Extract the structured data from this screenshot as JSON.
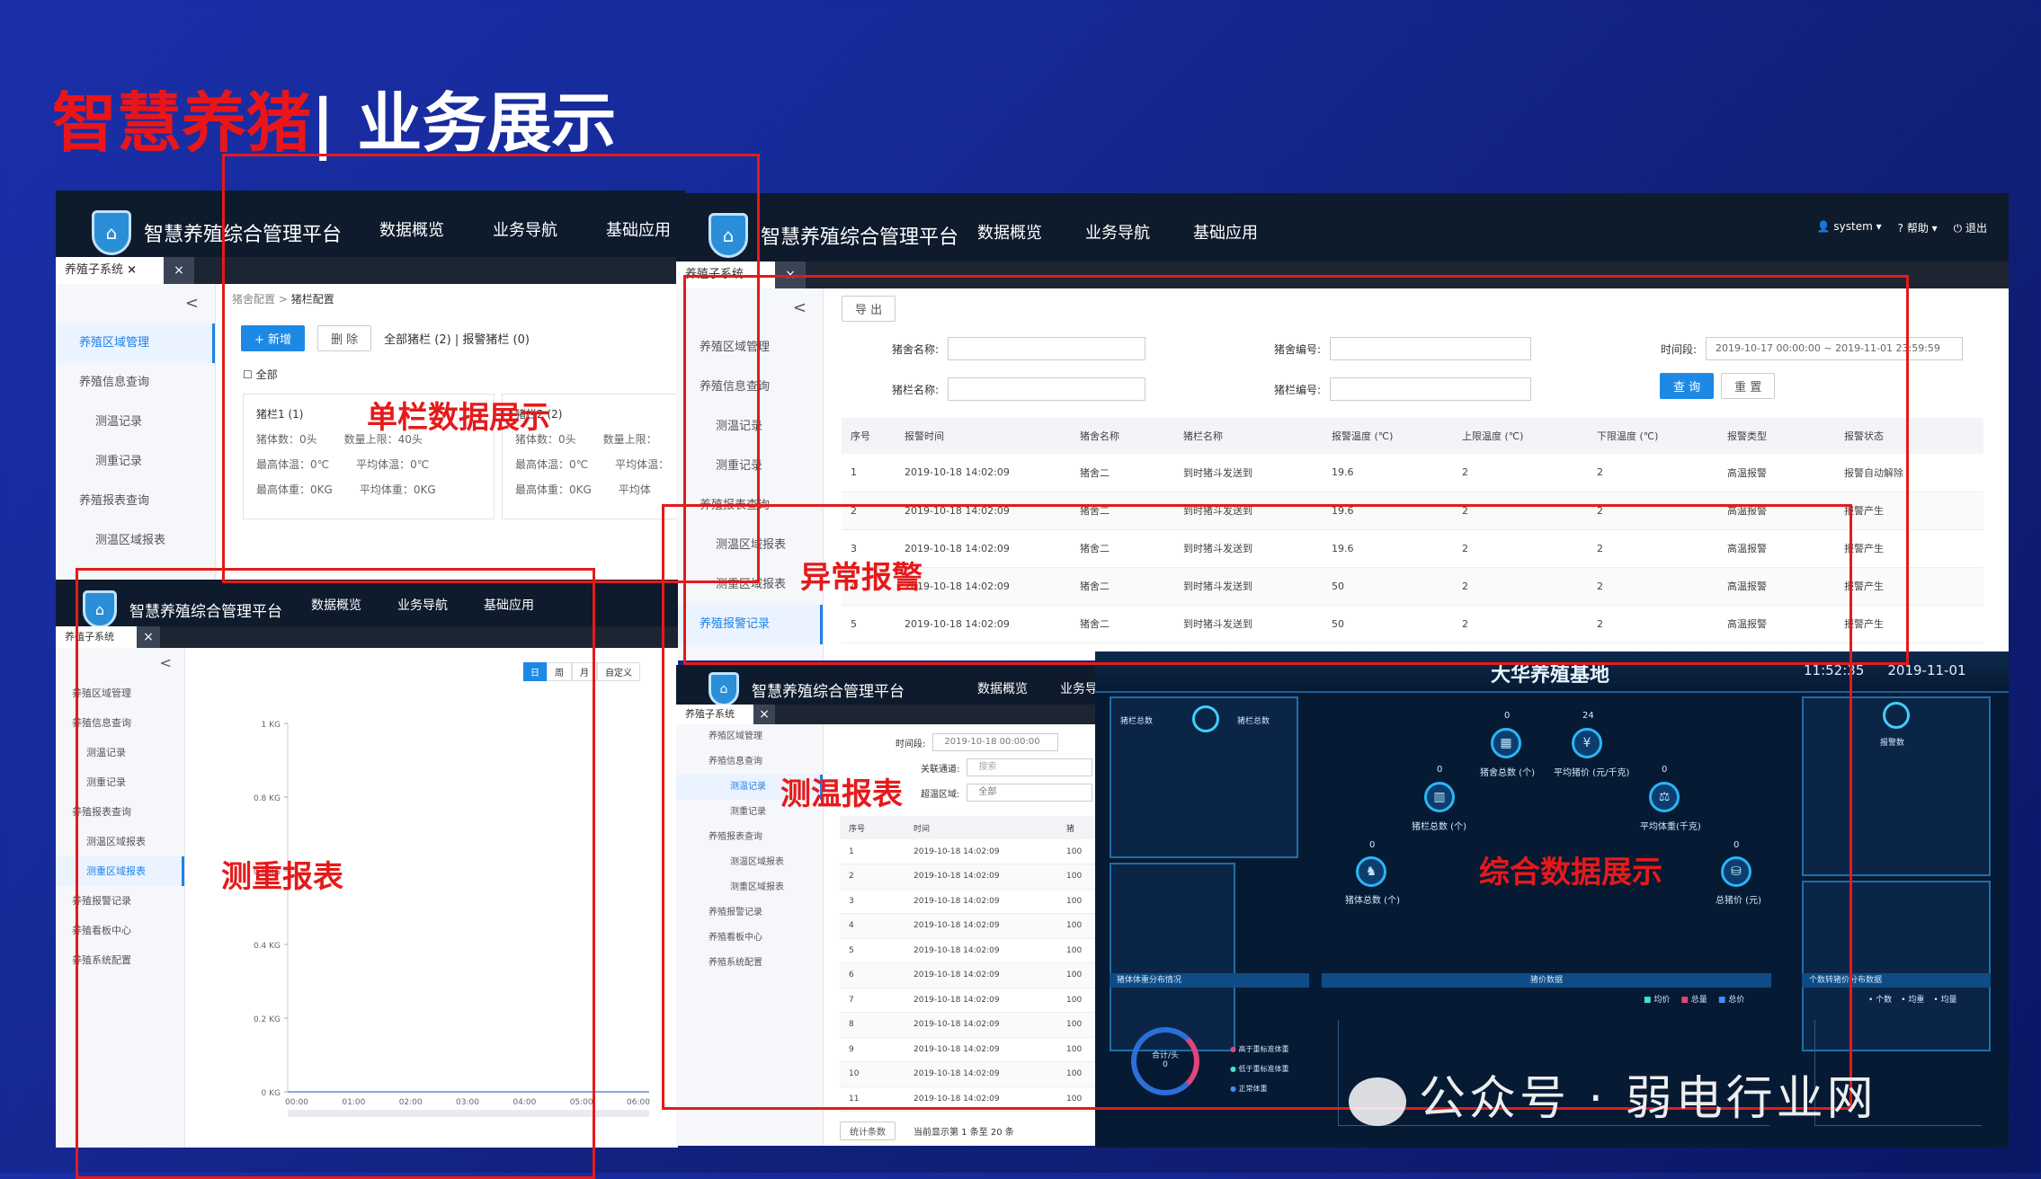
{
  "slide": {
    "title_red": "智慧养猪",
    "title_white": "| 业务展示"
  },
  "app": {
    "name": "智慧养殖综合管理平台",
    "nav": [
      "数据概览",
      "业务导航",
      "基础应用"
    ],
    "tab": "养殖子系统",
    "tab_close": "×",
    "user": "system",
    "help": "帮助",
    "logout": "退出"
  },
  "sidebar": {
    "collapse": "<",
    "items": [
      "养殖区域管理",
      "养殖信息查询",
      "测温记录",
      "测重记录",
      "养殖报表查询",
      "测温区域报表",
      "测重区域报表",
      "养殖报警记录",
      "养殖看板中心",
      "养殖系统配置"
    ]
  },
  "screen1": {
    "breadcrumb_root": "猪舍配置",
    "breadcrumb_sep": ">",
    "breadcrumb_current": "猪栏配置",
    "add": "+ 新增",
    "delete": "删 除",
    "stats": "全部猪栏 (2) | 报警猪栏 (0)",
    "select_all": "全部",
    "pens": [
      {
        "name": "猪栏1 (1)",
        "count": "猪体数：0头",
        "max": "数量上限：40头",
        "maxtemp": "最高体温：0℃",
        "avgtemp": "平均体温：0℃",
        "maxweight": "最高体重：0KG",
        "avgweight": "平均体重：0KG"
      },
      {
        "name": "猪栏2 (2)",
        "count": "猪体数：0头",
        "max": "数量上限：",
        "maxtemp": "最高体温：0℃",
        "avgtemp": "平均体温：",
        "maxweight": "最高体重：0KG",
        "avgweight": "平均体"
      }
    ],
    "label": "单栏数据展示"
  },
  "screen2": {
    "export": "导 出",
    "f_house_name": "猪舍名称:",
    "f_house_no": "猪舍编号:",
    "f_pen_name": "猪栏名称:",
    "f_pen_no": "猪栏编号:",
    "f_time": "时间段:",
    "time_value": "2019-10-17 00:00:00  ~  2019-11-01 23:59:59",
    "search": "查 询",
    "reset": "重 置",
    "headers": [
      "序号",
      "报警时间",
      "猪舍名称",
      "猪栏名称",
      "报警温度 (℃)",
      "上限温度 (℃)",
      "下限温度 (℃)",
      "报警类型",
      "报警状态"
    ],
    "rows": [
      [
        "1",
        "2019-10-18 14:02:09",
        "猪舍二",
        "到时猪斗发送到",
        "19.6",
        "2",
        "2",
        "高温报警",
        "报警自动解除"
      ],
      [
        "2",
        "2019-10-18 14:02:09",
        "猪舍二",
        "到时猪斗发送到",
        "19.6",
        "2",
        "2",
        "高温报警",
        "报警产生"
      ],
      [
        "3",
        "2019-10-18 14:02:09",
        "猪舍二",
        "到时猪斗发送到",
        "19.6",
        "2",
        "2",
        "高温报警",
        "报警产生"
      ],
      [
        "4",
        "2019-10-18 14:02:09",
        "猪舍二",
        "到时猪斗发送到",
        "50",
        "2",
        "2",
        "高温报警",
        "报警产生"
      ],
      [
        "5",
        "2019-10-18 14:02:09",
        "猪舍二",
        "到时猪斗发送到",
        "50",
        "2",
        "2",
        "高温报警",
        "报警产生"
      ]
    ],
    "label": "异常报警"
  },
  "screen3": {
    "toggles": [
      "日",
      "周",
      "月",
      "自定义"
    ],
    "yticks": [
      "1 KG",
      "0.8 KG",
      "0.6 KG",
      "0.4 KG",
      "0.2 KG",
      "0 KG"
    ],
    "xticks": [
      "00:00",
      "01:00",
      "02:00",
      "03:00",
      "04:00",
      "05:00",
      "06:00"
    ],
    "label": "测重报表"
  },
  "screen4": {
    "time_label": "时间段:",
    "time_value": "2019-10-18 00:00:00",
    "channel_label": "关联通道:",
    "channel_ph": "搜索",
    "area_label": "超温区域:",
    "area_value": "全部",
    "headers": [
      "序号",
      "时间",
      "猪"
    ],
    "rows": [
      [
        "1",
        "2019-10-18 14:02:09",
        "100"
      ],
      [
        "2",
        "2019-10-18 14:02:09",
        "100"
      ],
      [
        "3",
        "2019-10-18 14:02:09",
        "100"
      ],
      [
        "4",
        "2019-10-18 14:02:09",
        "100"
      ],
      [
        "5",
        "2019-10-18 14:02:09",
        "100"
      ],
      [
        "6",
        "2019-10-18 14:02:09",
        "100"
      ],
      [
        "7",
        "2019-10-18 14:02:09",
        "100"
      ],
      [
        "8",
        "2019-10-18 14:02:09",
        "100"
      ],
      [
        "9",
        "2019-10-18 14:02:09",
        "100"
      ],
      [
        "10",
        "2019-10-18 14:02:09",
        "100"
      ],
      [
        "11",
        "2019-10-18 14:02:09",
        "100"
      ]
    ],
    "footer_count": "统计条数",
    "footer_page": "当前显示第 1 条至 20 条",
    "label": "测温报表"
  },
  "screen5": {
    "title": "大华养殖基地",
    "time": "11:52:35",
    "date": "2019-11-01",
    "left_tabs": [
      "猪栏总数",
      "猪栏总数"
    ],
    "right_label": "报警数",
    "nodes": [
      {
        "value": "0",
        "label": "猪舍总数 (个)",
        "icon": "▦"
      },
      {
        "value": "24",
        "label": "平均猪价 (元/千克)",
        "icon": "¥"
      },
      {
        "value": "0",
        "label": "猪栏总数 (个)",
        "icon": "▥"
      },
      {
        "value": "0",
        "label": "平均体重(千克)",
        "icon": "⚖"
      },
      {
        "value": "0",
        "label": "猪体总数 (个)",
        "icon": "♞"
      },
      {
        "value": "0",
        "label": "总猪价 (元)",
        "icon": "⛁"
      }
    ],
    "bottom_titles": [
      "猪体体重分布情况",
      "猪价数据",
      "个数转猪价分布数据"
    ],
    "legend_mid": [
      "均价",
      "总量",
      "总价"
    ],
    "legend_right": [
      "个数",
      "均重",
      "均量"
    ],
    "donut_label": "合计/头",
    "donut_value": "0",
    "pie_legend": [
      "高于重标准体重",
      "低于重标准体重",
      "正常体重"
    ],
    "label": "综合数据展示",
    "colors": {
      "accent": "#3fd0ff",
      "bg": "#071a33"
    }
  },
  "watermark": "公众号 · 弱电行业网"
}
